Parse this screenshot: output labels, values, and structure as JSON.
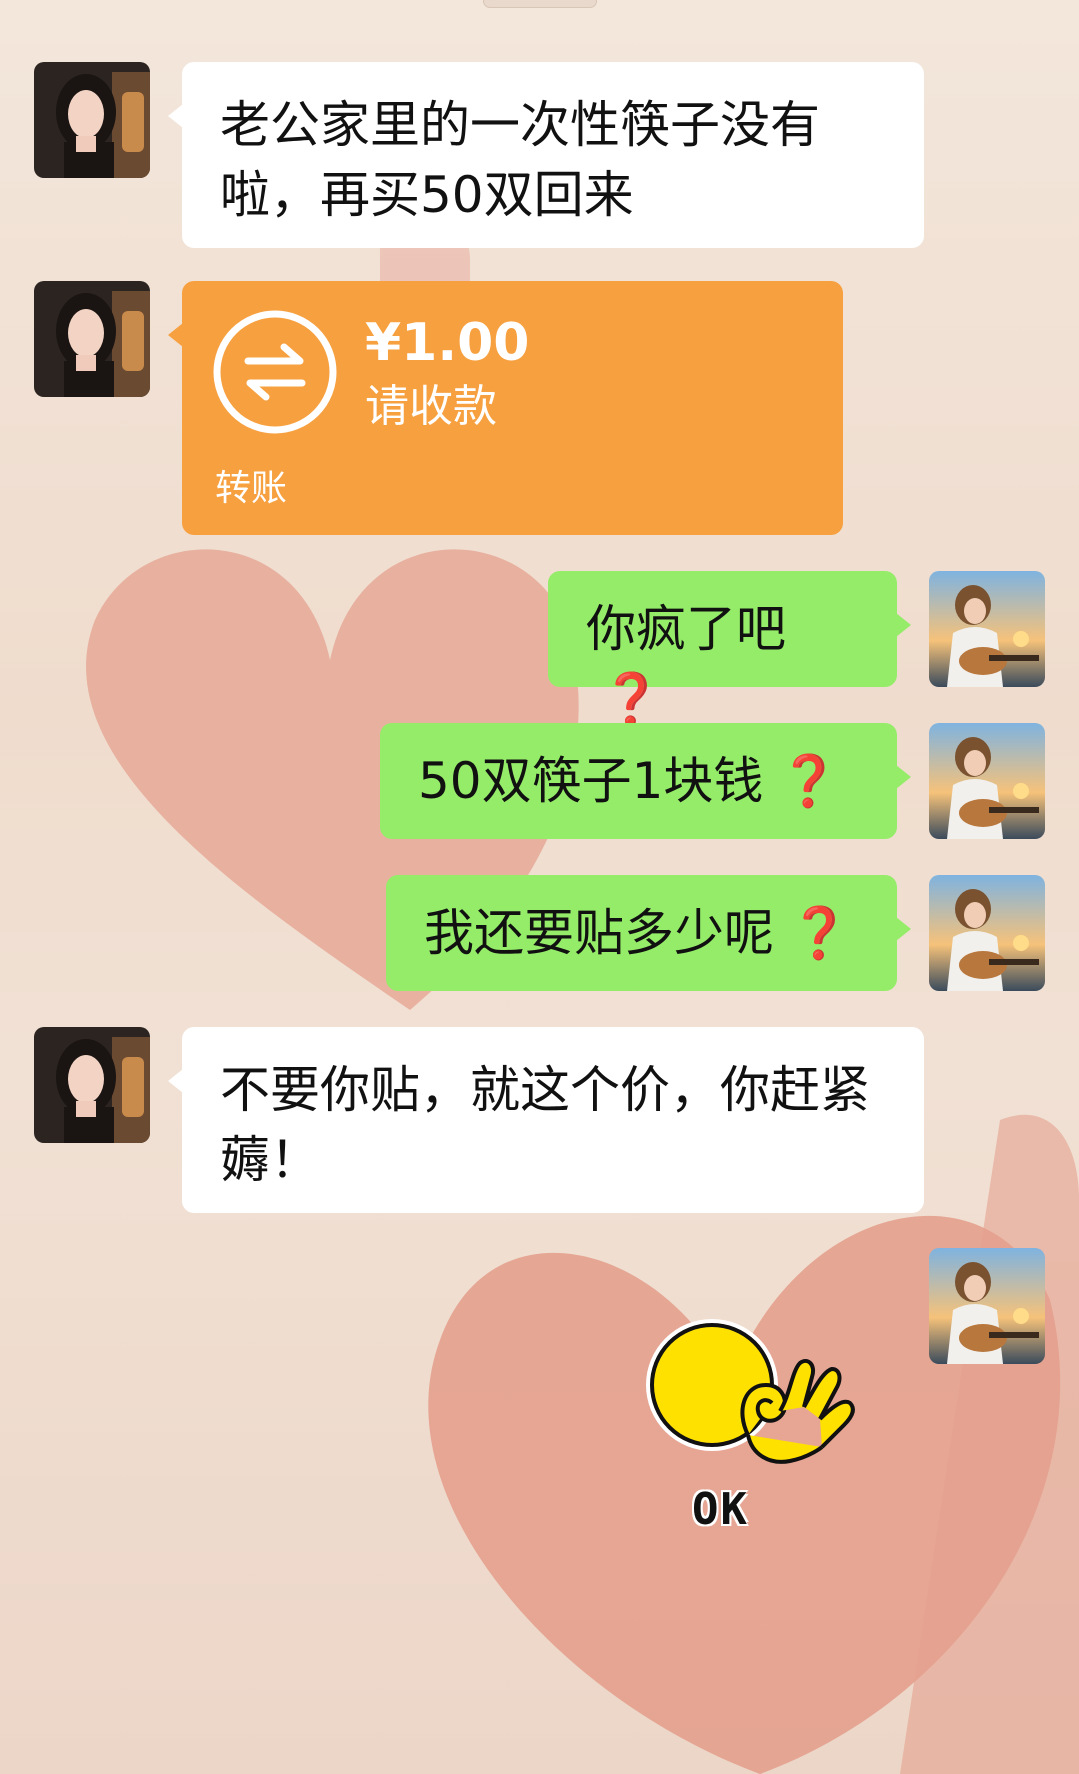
{
  "messages": [
    {
      "sender": "wife",
      "type": "text",
      "text": "老公家里的一次性筷子没有啦，再买50双回来"
    },
    {
      "sender": "wife",
      "type": "transfer",
      "amount": "¥1.00",
      "status": "请收款",
      "label": "转账"
    },
    {
      "sender": "me",
      "type": "text",
      "text": "你疯了吧",
      "suffix": "❓"
    },
    {
      "sender": "me",
      "type": "text",
      "text": "50双筷子1块钱",
      "suffix": "❓"
    },
    {
      "sender": "me",
      "type": "text",
      "text": "我还要贴多少呢",
      "suffix": "❓"
    },
    {
      "sender": "wife",
      "type": "text",
      "text": "不要你贴，就这个价，你赶紧薅！"
    },
    {
      "sender": "me",
      "type": "sticker",
      "icon": "ok-hand-emoji-icon",
      "label": "OK"
    }
  ],
  "colors": {
    "white_bubble": "#ffffff",
    "green_bubble": "#95ec69",
    "transfer_orange": "#f7a03f",
    "question_mark": "#e8202a"
  }
}
